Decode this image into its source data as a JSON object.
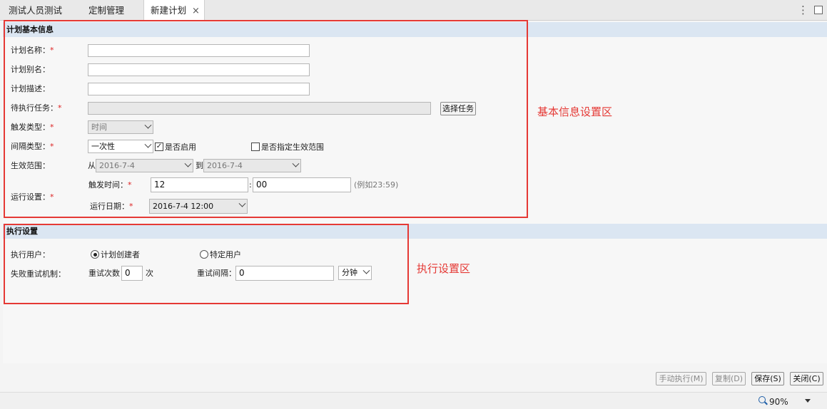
{
  "tabs": [
    {
      "label": "测试人员测试"
    },
    {
      "label": "定制管理"
    },
    {
      "label": "新建计划",
      "close": "×"
    }
  ],
  "window_controls": {
    "more": "⋮"
  },
  "basic": {
    "section_title": "计划基本信息",
    "plan_name_label": "计划名称：",
    "plan_alias_label": "计划别名：",
    "plan_desc_label": "计划描述：",
    "pending_task_label": "待执行任务：",
    "select_task_button": "选择任务",
    "trigger_type_label": "触发类型：",
    "trigger_type_value": "时间",
    "interval_type_label": "间隔类型：",
    "interval_type_value": "一次性",
    "enabled_label": "是否启用",
    "enabled_checked": true,
    "specify_range_label": "是否指定生效范围",
    "specify_range_checked": false,
    "effective_range_label": "生效范围：",
    "from_label": "从",
    "from_value": "2016-7-4",
    "to_label": "到",
    "to_value": "2016-7-4",
    "run_settings_label": "运行设置：",
    "trigger_time_label": "触发时间：",
    "hour_value": "12",
    "time_sep": ":",
    "minute_value": "00",
    "time_hint": "(例如23:59)",
    "run_date_label": "运行日期：",
    "run_date_value": "2016-7-4 12:00",
    "required_mark": "*"
  },
  "exec": {
    "section_title": "执行设置",
    "exec_user_label": "执行用户：",
    "creator_option": "计划创建者",
    "specific_user_option": "特定用户",
    "selected_user": "计划创建者",
    "retry_label": "失败重试机制：",
    "retry_count_label": "重试次数",
    "retry_count_value": "0",
    "retry_count_unit": "次",
    "retry_interval_label": "重试间隔：",
    "retry_interval_value": "0",
    "retry_interval_unit": "分钟"
  },
  "annotations": {
    "basic_area": "基本信息设置区",
    "exec_area": "执行设置区",
    "color": "#e53935"
  },
  "footer": {
    "manual_run": "手动执行(M)",
    "copy": "复制(D)",
    "save": "保存(S)",
    "close": "关闭(C)"
  },
  "status": {
    "zoom": "90%"
  }
}
